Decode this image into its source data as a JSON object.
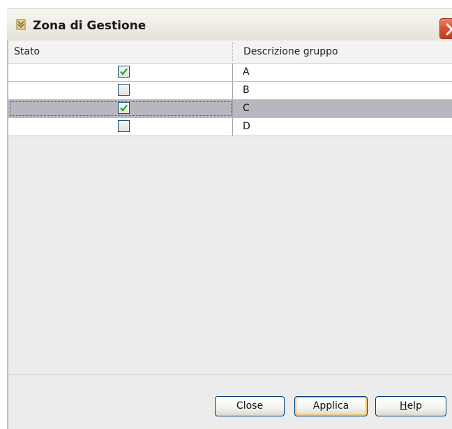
{
  "window": {
    "title": "Zona di Gestione"
  },
  "table": {
    "columns": [
      "Stato",
      "Descrizione gruppo"
    ],
    "rows": [
      {
        "checked": true,
        "description": "A",
        "selected": false
      },
      {
        "checked": false,
        "description": "B",
        "selected": false
      },
      {
        "checked": true,
        "description": "C",
        "selected": true
      },
      {
        "checked": false,
        "description": "D",
        "selected": false
      }
    ]
  },
  "buttons": {
    "close": "Close",
    "applica": "Applica",
    "help_mnemonic": "H",
    "help_rest": "elp"
  },
  "colors": {
    "title_bar": "#eeece4",
    "close_button": "#d5502f",
    "selected_row": "#b7b7bf",
    "check_mark": "#21a121",
    "panel_background": "#ececec"
  }
}
